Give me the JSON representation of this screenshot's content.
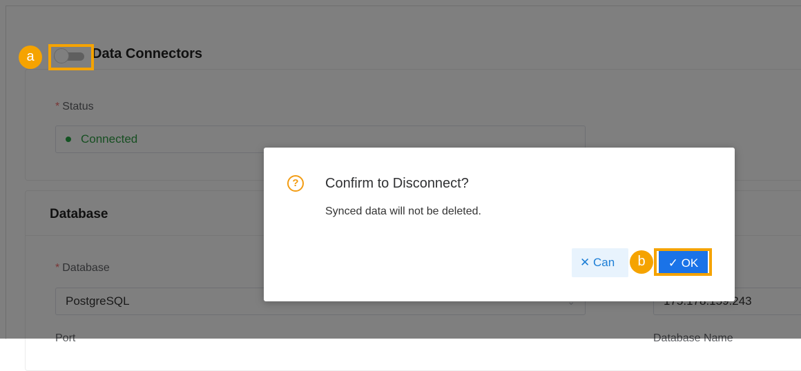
{
  "section": {
    "title": "Data Connectors"
  },
  "status": {
    "label": "Status",
    "required_mark": "*",
    "value": "Connected"
  },
  "database_section": {
    "title": "Database",
    "database_label": "Database",
    "database_value": "PostgreSQL",
    "host_value": "175.178.159.243",
    "port_label": "Port",
    "database_name_label": "Database Name"
  },
  "dialog": {
    "title": "Confirm to Disconnect?",
    "message": "Synced data will not be deleted.",
    "cancel_label": "Can",
    "ok_label": "OK"
  },
  "markers": {
    "a": "a",
    "b": "b"
  },
  "icons": {
    "question": "question-circle-icon",
    "cancel": "close-icon",
    "ok": "check-icon",
    "dropdown": "chevron-down-icon"
  },
  "colors": {
    "accent": "#1a73e8",
    "marker": "#f5a300",
    "warning": "#f39c12",
    "connected": "#27a745"
  }
}
